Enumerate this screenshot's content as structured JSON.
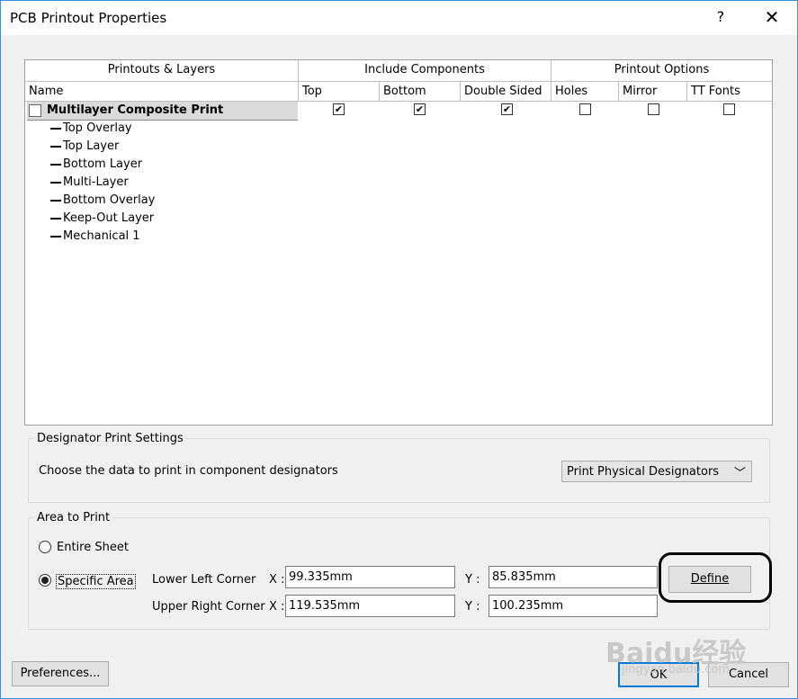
{
  "window": {
    "title": "PCB Printout Properties",
    "help": "?",
    "close": "✕"
  },
  "grid": {
    "groups": {
      "printouts_layers": "Printouts & Layers",
      "include_components": "Include Components",
      "printout_options": "Printout Options"
    },
    "columns": {
      "name": "Name",
      "top": "Top",
      "bottom": "Bottom",
      "double_sided": "Double Sided",
      "holes": "Holes",
      "mirror": "Mirror",
      "tt_fonts": "TT Fonts"
    },
    "printout": {
      "name": "Multilayer Composite Print",
      "top": true,
      "bottom": true,
      "double_sided": true,
      "holes": false,
      "mirror": false,
      "tt_fonts": false
    },
    "layers": [
      "Top Overlay",
      "Top Layer",
      "Bottom Layer",
      "Multi-Layer",
      "Bottom Overlay",
      "Keep-Out Layer",
      "Mechanical 1"
    ]
  },
  "designator": {
    "group_title": "Designator Print Settings",
    "prompt": "Choose the data to print in component designators",
    "selected": "Print Physical Designators"
  },
  "area": {
    "group_title": "Area to Print",
    "entire_sheet": "Entire Sheet",
    "specific_area": "Specific Area",
    "selected": "specific_area",
    "lower_left_label": "Lower Left Corner",
    "upper_right_label": "Upper Right Corner",
    "x_label": "X :",
    "y_label": "Y :",
    "lower_left_x": "99.335mm",
    "lower_left_y": "85.835mm",
    "upper_right_x": "119.535mm",
    "upper_right_y": "100.235mm",
    "define_button": "Define"
  },
  "footer": {
    "preferences_button": "Preferences...",
    "ok_button": "OK",
    "cancel_button": "Cancel"
  },
  "watermark": {
    "text": "Baidu经验",
    "url": "jingyan.baidu.com"
  }
}
